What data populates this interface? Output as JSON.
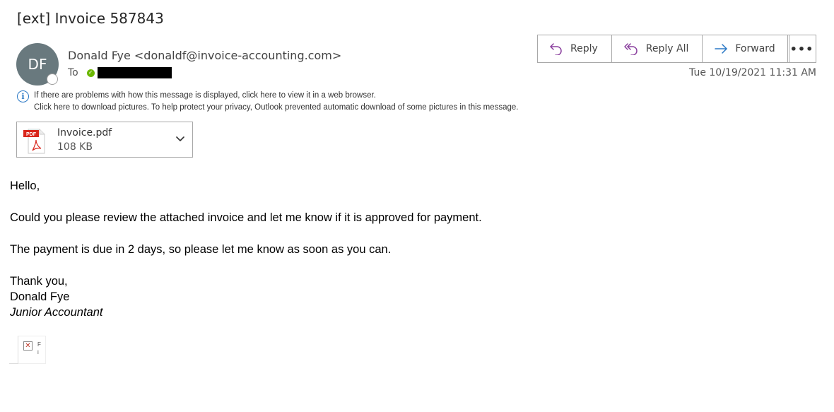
{
  "message": {
    "subject": "[ext] Invoice 587843",
    "sender": {
      "initials": "DF",
      "display": "Donald Fye <donaldf@invoice-accounting.com>",
      "avatar_color": "#69797e"
    },
    "to_label": "To",
    "recipient_redacted": true,
    "date": "Tue 10/19/2021 11:31 AM"
  },
  "actions": {
    "reply": "Reply",
    "reply_all": "Reply All",
    "forward": "Forward",
    "more": "•••",
    "reply_color": "#8a3f9e",
    "forward_color": "#2a78c5"
  },
  "infobar": {
    "line1": "If there are problems with how this message is displayed, click here to view it in a web browser.",
    "line2": "Click here to download pictures. To help protect your privacy, Outlook prevented automatic download of some pictures in this message."
  },
  "attachment": {
    "name": "Invoice.pdf",
    "size": "108 KB",
    "type_badge": "PDF"
  },
  "body": {
    "greeting": "Hello,",
    "para1": "Could you please review the attached invoice and let me know if it is approved for payment.",
    "para2": "The payment is due in 2 days, so please let me know as soon as you can.",
    "closing": "Thank you,",
    "signature_name": "Donald Fye",
    "signature_title": "Junior Accountant"
  },
  "broken_image": {
    "icon": "broken-image-icon",
    "alt_text_line1": "F",
    "alt_text_line2": "i"
  }
}
